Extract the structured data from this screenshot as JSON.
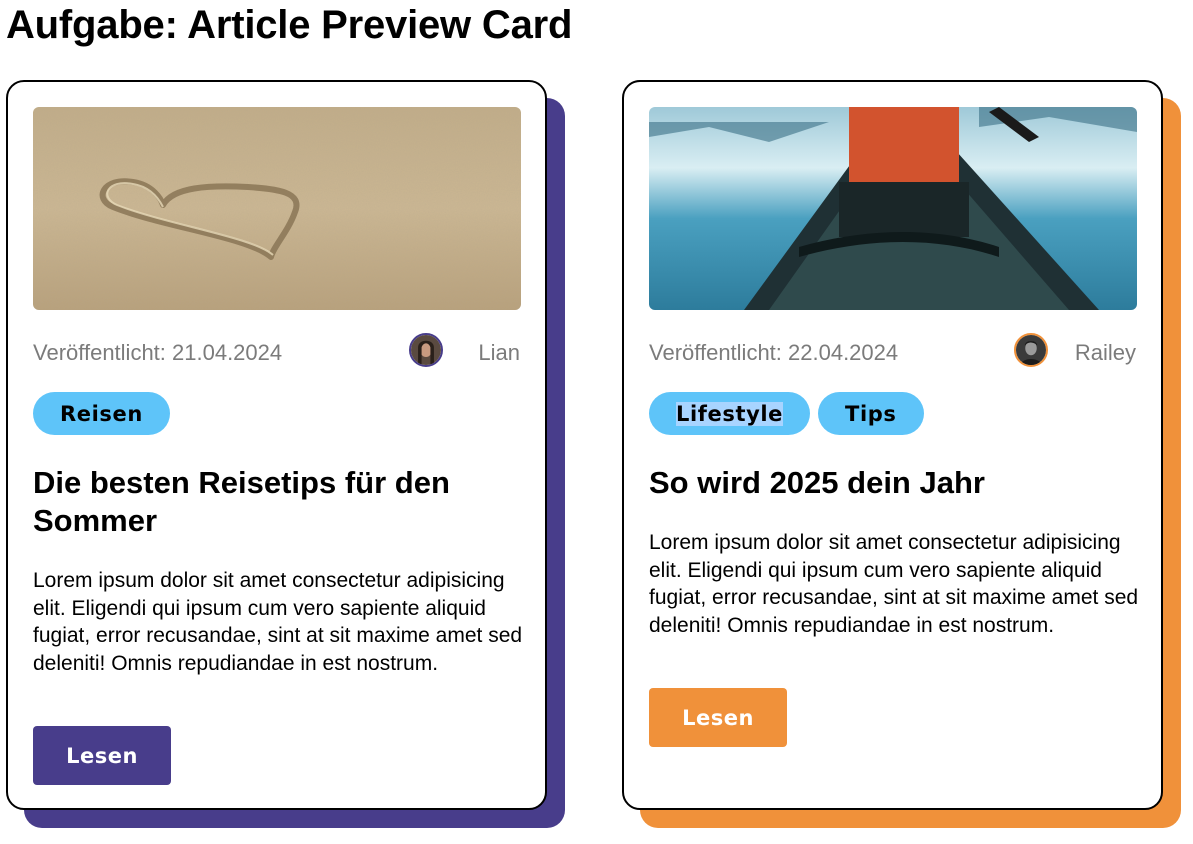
{
  "page": {
    "title": "Aufgabe: Article Preview Card"
  },
  "cards": [
    {
      "date": "Veröffentlicht: 21.04.2024",
      "author": "Lian",
      "tags": [
        "Reisen"
      ],
      "title": "Die besten Reisetips für den Sommer",
      "body": "Lorem ipsum dolor sit amet consectetur adipisicing elit. Eligendi qui ipsum cum vero sapiente aliquid fugiat, error recusandae, sint at sit maxime amet sed deleniti! Omnis repudiandae in est nostrum.",
      "button_label": "Lesen",
      "accent": "#483d8b"
    },
    {
      "date": "Veröffentlicht: 22.04.2024",
      "author": "Railey",
      "tags": [
        "Lifestyle",
        "Tips"
      ],
      "title": "So wird 2025 dein Jahr",
      "body": "Lorem ipsum dolor sit amet consectetur adipisicing elit. Eligendi qui ipsum cum vero sapiente aliquid fugiat, error recusandae, sint at sit maxime amet sed deleniti! Omnis repudiandae in est nostrum.",
      "button_label": "Lesen",
      "accent": "#f0913a"
    }
  ],
  "colors": {
    "tag_bg": "#5ec4f9",
    "muted_text": "#7b7b7b"
  }
}
